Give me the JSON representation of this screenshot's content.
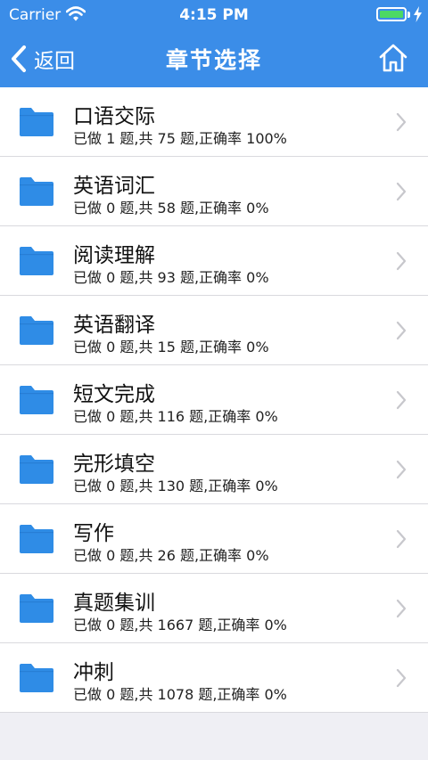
{
  "status": {
    "carrier": "Carrier",
    "time": "4:15 PM"
  },
  "nav": {
    "back_label": "返回",
    "title": "章节选择"
  },
  "chapters": [
    {
      "title": "口语交际",
      "summary": "已做 1 题,共 75 题,正确率 100%"
    },
    {
      "title": "英语词汇",
      "summary": "已做 0 题,共 58 题,正确率 0%"
    },
    {
      "title": "阅读理解",
      "summary": "已做 0 题,共 93 题,正确率 0%"
    },
    {
      "title": "英语翻译",
      "summary": "已做 0 题,共 15 题,正确率 0%"
    },
    {
      "title": "短文完成",
      "summary": "已做 0 题,共 116 题,正确率 0%"
    },
    {
      "title": "完形填空",
      "summary": "已做 0 题,共 130 题,正确率 0%"
    },
    {
      "title": "写作",
      "summary": "已做 0 题,共 26 题,正确率 0%"
    },
    {
      "title": "真题集训",
      "summary": "已做 0 题,共 1667 题,正确率 0%"
    },
    {
      "title": "冲刺",
      "summary": "已做 0 题,共 1078 题,正确率 0%"
    }
  ],
  "icons": {
    "folder": "folder-icon",
    "chevron": "chevron-right-icon",
    "home": "home-icon",
    "back": "chevron-left-icon"
  },
  "colors": {
    "nav_bar": "#3b8de8",
    "folder": "#2f8ce6",
    "battery": "#4cd964",
    "background": "#efeff4"
  }
}
